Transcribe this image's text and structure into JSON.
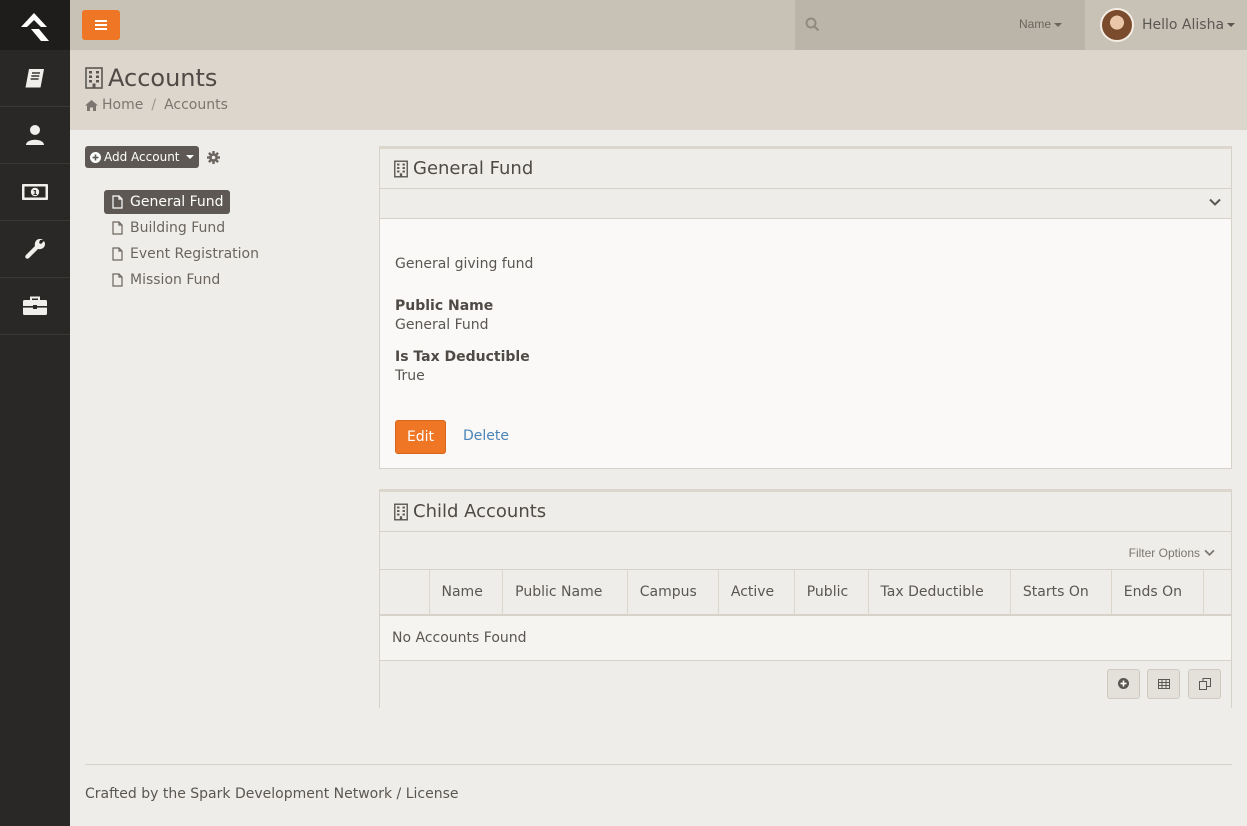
{
  "topbar": {
    "search_placeholder": "",
    "search_filter_label": "Name",
    "greeting": "Hello Alisha"
  },
  "sidebar": {
    "items": [
      {
        "icon": "book-icon"
      },
      {
        "icon": "person-icon"
      },
      {
        "icon": "money-icon"
      },
      {
        "icon": "wrench-icon"
      },
      {
        "icon": "briefcase-icon"
      }
    ]
  },
  "page": {
    "title": "Accounts",
    "breadcrumb": [
      "Home",
      "Accounts"
    ]
  },
  "tree": {
    "add_label": "Add Account",
    "items": [
      "General Fund",
      "Building Fund",
      "Event Registration",
      "Mission Fund"
    ],
    "selected": "General Fund"
  },
  "detail": {
    "title": "General Fund",
    "description": "General giving fund",
    "fields": [
      {
        "label": "Public Name",
        "value": "General Fund"
      },
      {
        "label": "Is Tax Deductible",
        "value": "True"
      }
    ],
    "edit_label": "Edit",
    "delete_label": "Delete"
  },
  "child_accounts": {
    "title": "Child Accounts",
    "filter_label": "Filter Options",
    "columns": [
      "Name",
      "Public Name",
      "Campus",
      "Active",
      "Public",
      "Tax Deductible",
      "Starts On",
      "Ends On"
    ],
    "empty_text": "No Accounts Found"
  },
  "footer": {
    "text": "Crafted by the Spark Development Network / License"
  },
  "colors": {
    "accent": "#ee7624",
    "sidebar": "#2a2826",
    "topbar": "#c8c2b6",
    "link": "#4b84b8"
  }
}
